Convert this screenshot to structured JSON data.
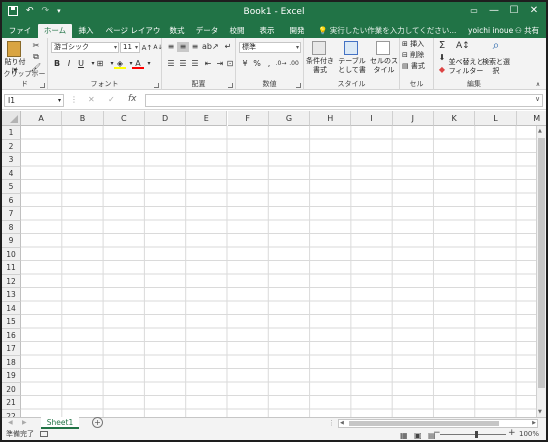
{
  "window": {
    "title": "Book1 - Excel"
  },
  "title_controls": {
    "min": "—",
    "max": "☐",
    "close": "✕"
  },
  "ribbon_tabs": [
    {
      "label": "ファイル"
    },
    {
      "label": "ホーム"
    },
    {
      "label": "挿入"
    },
    {
      "label": "ページ レイアウト"
    },
    {
      "label": "数式"
    },
    {
      "label": "データ"
    },
    {
      "label": "校閲"
    },
    {
      "label": "表示"
    },
    {
      "label": "開発"
    }
  ],
  "tell_me": "実行したい作業を入力してください...",
  "user": "yoichi inoue",
  "share": "共有",
  "clipboard": {
    "paste_label": "貼り付け",
    "group_label": "クリップボード"
  },
  "font": {
    "name": "游ゴシック",
    "size": "11",
    "group_label": "フォント",
    "bold": "B",
    "italic": "I",
    "underline": "U"
  },
  "alignment": {
    "group_label": "配置"
  },
  "number": {
    "format": "標準",
    "group_label": "数値",
    "currency": "¥",
    "percent": "%",
    "comma": ","
  },
  "styles": {
    "group_label": "スタイル",
    "conditional": "条件付き書式",
    "table": "テーブルとして書式設定",
    "cell_styles": "セルのスタイル"
  },
  "cells_group": {
    "group_label": "セル",
    "insert": "挿入",
    "delete": "削除",
    "format": "書式"
  },
  "editing": {
    "group_label": "編集",
    "sort": "並べ替えとフィルター",
    "find": "検索と選択"
  },
  "formula_bar": {
    "name_box": "I1",
    "fx": "fx",
    "cancel": "✕",
    "enter": "✓",
    "value": ""
  },
  "columns": [
    "A",
    "B",
    "C",
    "D",
    "E",
    "F",
    "G",
    "H",
    "I",
    "J",
    "K",
    "L",
    "M"
  ],
  "rows": [
    "1",
    "2",
    "3",
    "4",
    "5",
    "6",
    "7",
    "8",
    "9",
    "10",
    "11",
    "12",
    "13",
    "14",
    "15",
    "16",
    "17",
    "18",
    "19",
    "20",
    "21",
    "22"
  ],
  "sheets": [
    {
      "name": "Sheet1"
    }
  ],
  "add_sheet": "+",
  "status": {
    "ready": "準備完了",
    "zoom": "100%",
    "minus": "−",
    "plus": "+"
  }
}
